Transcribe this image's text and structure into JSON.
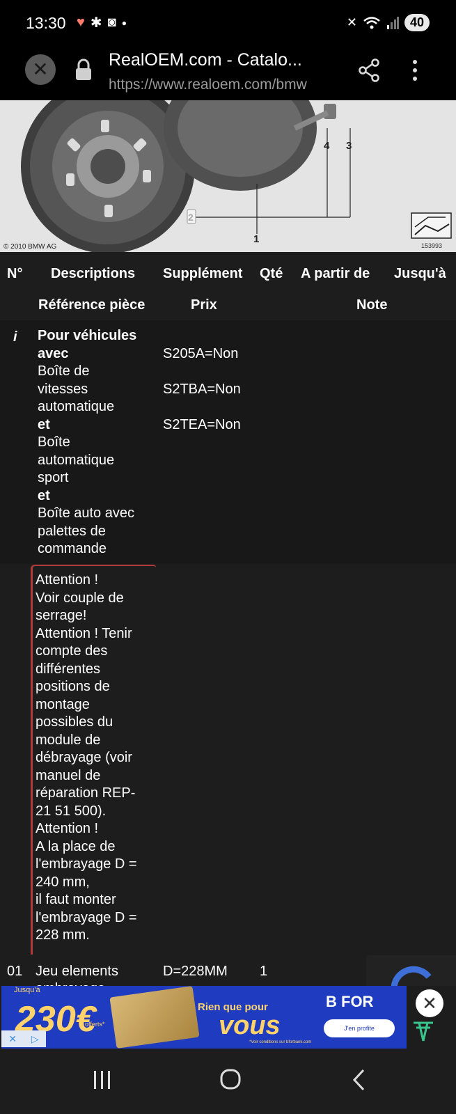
{
  "status_bar": {
    "time": "13:30",
    "battery": "40",
    "icons_left": [
      "heart-icon",
      "flower-icon",
      "dog-icon",
      "dot-icon"
    ],
    "icons_right": [
      "mute-icon",
      "wifi-6e-icon",
      "signal-icon",
      "battery-icon"
    ]
  },
  "browser": {
    "page_title": "RealOEM.com - Catalo...",
    "url": "https://www.realoem.com/bmw",
    "close_icon": "close-icon",
    "lock_icon": "lock-icon",
    "share_icon": "share-icon",
    "menu_icon": "more-vert-icon"
  },
  "diagram": {
    "copyright": "© 2010 BMW AG",
    "image_number": "153993",
    "callouts": [
      "4",
      "3",
      "2",
      "1"
    ]
  },
  "table": {
    "headers_row1": [
      "N°",
      "Descriptions",
      "Supplément",
      "Qté",
      "A partir de",
      "Jusqu'à"
    ],
    "headers_row2": [
      "Référence pièce",
      "Prix",
      "Note"
    ],
    "info_row": {
      "marker": "i",
      "lines": [
        {
          "text": "Pour véhicules",
          "bold": true
        },
        {
          "text": "avec",
          "bold": true
        },
        {
          "text": "Boîte de",
          "bold": false
        },
        {
          "text": "vitesses",
          "bold": false
        },
        {
          "text": "automatique",
          "bold": false
        },
        {
          "text": "et",
          "bold": true
        },
        {
          "text": "Boîte",
          "bold": false
        },
        {
          "text": "automatique",
          "bold": false
        },
        {
          "text": "sport",
          "bold": false
        },
        {
          "text": "et",
          "bold": true
        },
        {
          "text": "Boîte auto avec",
          "bold": false
        },
        {
          "text": "palettes de",
          "bold": false
        },
        {
          "text": "commande",
          "bold": false
        }
      ],
      "supplements": [
        "S205A=Non",
        "S2TBA=Non",
        "S2TEA=Non"
      ]
    },
    "note_lines": [
      "Attention !",
      "Voir couple de",
      "serrage!",
      "Attention ! Tenir",
      "compte des",
      "différentes",
      "positions de",
      "montage",
      "possibles du",
      "module de",
      "débrayage (voir",
      "manuel de",
      "réparation REP-",
      "21 51 500).",
      "Attention !",
      "A la place de",
      "l'embrayage D =",
      "240 mm,",
      "il faut monter",
      "l'embrayage D =",
      "228 mm."
    ],
    "part_row": {
      "number": "01",
      "description_line1": "Jeu elements",
      "description_line2": "embrayage",
      "supplement": "D=228MM",
      "qty": "1"
    }
  },
  "ad": {
    "top_label": "Jusqu'à",
    "price": "230€",
    "price_sub": "offerts*",
    "headline1": "Rien que pour",
    "headline2": "vous",
    "brand": "B FOR",
    "button_label": "J'en profite",
    "legal": "*Voir conditions sur bforbank.com",
    "brand_color": "#1f3bbf",
    "accent_color": "#ffd36a"
  }
}
